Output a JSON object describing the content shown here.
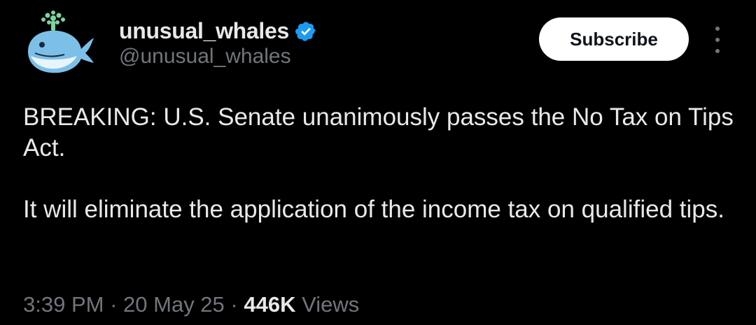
{
  "author": {
    "display_name": "unusual_whales",
    "handle": "@unusual_whales",
    "avatar_icon": "whale-avatar-icon",
    "verified_icon": "verified-badge-icon",
    "verified_color": "#1d9bf0"
  },
  "actions": {
    "subscribe_label": "Subscribe",
    "more_icon": "more-options-icon"
  },
  "tweet": {
    "paragraph_1": "BREAKING: U.S. Senate unanimously passes the No Tax on Tips Act.",
    "paragraph_2": "It will eliminate the application of the income tax on qualified tips."
  },
  "meta": {
    "time": "3:39 PM",
    "separator": "·",
    "date": "20 May 25",
    "views_count": "446K",
    "views_label": "Views"
  }
}
